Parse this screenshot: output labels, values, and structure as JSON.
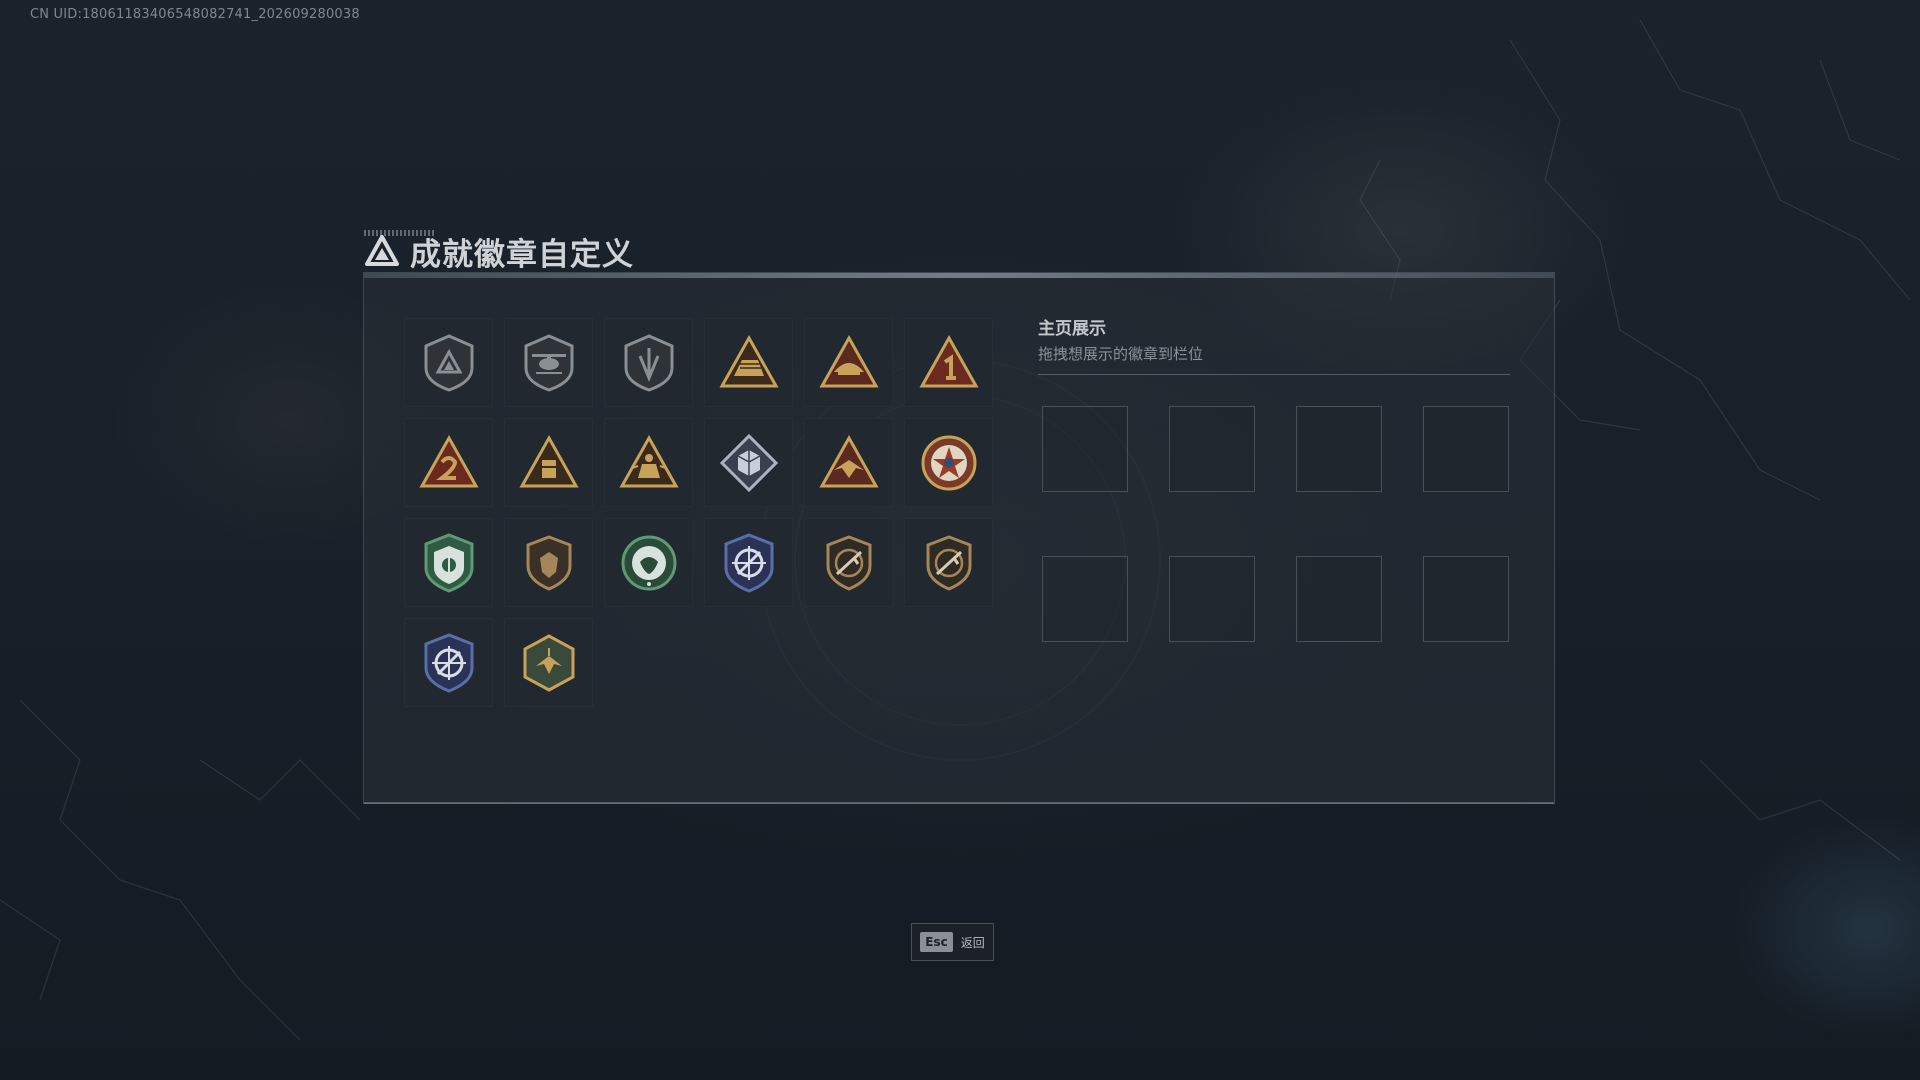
{
  "uid_text": "CN UID:18061183406548082741_202609280038",
  "dialog": {
    "title": "成就徽章自定义",
    "logo_icon": "triangle-logo-icon"
  },
  "badges": [
    {
      "icon": "shield-triangle-badge-icon",
      "color": "#8a8f94"
    },
    {
      "icon": "helicopter-badge-icon",
      "color": "#8a8f94"
    },
    {
      "icon": "shield-arrow-badge-icon",
      "color": "#8a8f94"
    },
    {
      "icon": "triangle-vehicle-badge-icon",
      "color": "#c9a25a"
    },
    {
      "icon": "triangle-helmet-badge-icon",
      "color": "#c9a25a"
    },
    {
      "icon": "triangle-number-one-badge-icon",
      "color": "#c9a25a"
    },
    {
      "icon": "triangle-number-two-badge-icon",
      "color": "#c9a25a"
    },
    {
      "icon": "triangle-crate-badge-icon",
      "color": "#c9a25a"
    },
    {
      "icon": "triangle-soldier-badge-icon",
      "color": "#c9a25a"
    },
    {
      "icon": "diamond-cube-badge-icon",
      "color": "#a9b3c2"
    },
    {
      "icon": "triangle-eagle-badge-icon",
      "color": "#c9a25a"
    },
    {
      "icon": "star-medal-badge-icon",
      "color": "#c9a25a"
    },
    {
      "icon": "green-shield-badge-icon",
      "color": "#5f9a74"
    },
    {
      "icon": "bronze-shield-badge-icon",
      "color": "#a5865a"
    },
    {
      "icon": "green-wreath-badge-icon",
      "color": "#5f9a74"
    },
    {
      "icon": "blue-crosshair-shield-badge-icon",
      "color": "#5a6fa8"
    },
    {
      "icon": "bronze-rifle-shield-badge-icon",
      "color": "#a5865a"
    },
    {
      "icon": "bronze-rifle-shield-badge-icon",
      "color": "#a5865a"
    },
    {
      "icon": "blue-crosshair-shield-badge-icon",
      "color": "#5a6fa8"
    },
    {
      "icon": "hexagon-bird-badge-icon",
      "color": "#c9a25a"
    }
  ],
  "showcase": {
    "title": "主页展示",
    "subtitle": "拖拽想展示的徽章到栏位",
    "slot_count": 8
  },
  "footer": {
    "esc_key": "Esc",
    "esc_label": "返回"
  }
}
